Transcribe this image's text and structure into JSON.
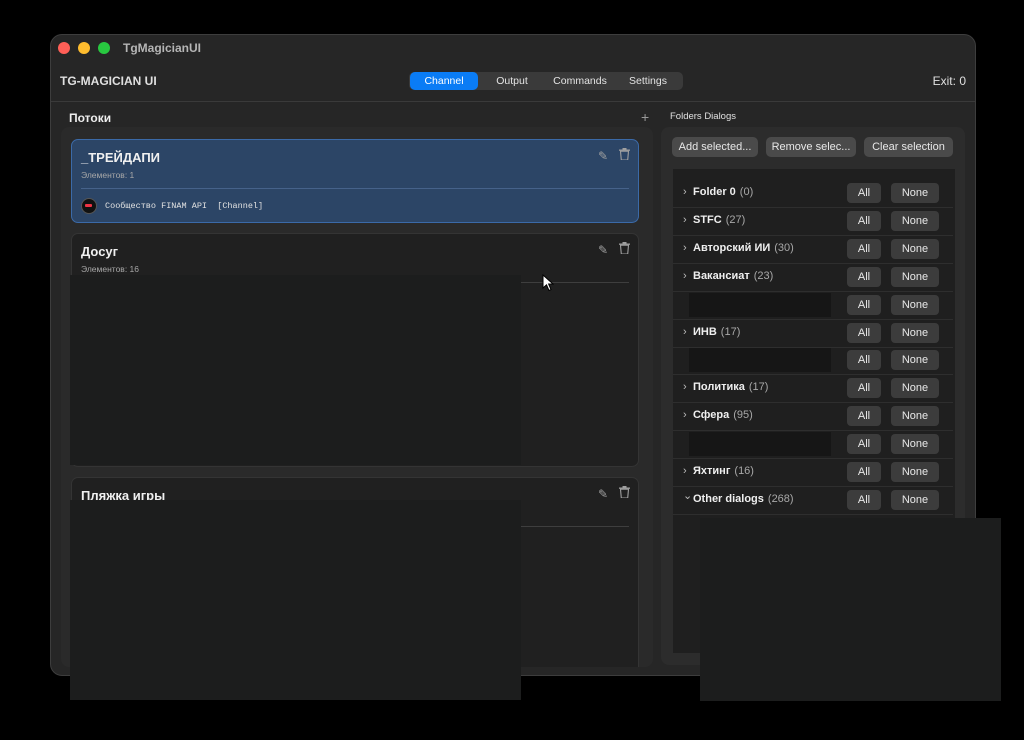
{
  "window": {
    "title": "TgMagicianUI"
  },
  "toolbar": {
    "app_title": "TG-MAGICIAN UI",
    "tabs": [
      "Channel",
      "Output",
      "Commands",
      "Settings"
    ],
    "active_tab": "Channel",
    "exit_label": "Exit: 0"
  },
  "left": {
    "title": "Потоки",
    "add_icon": "+",
    "cards": [
      {
        "title": "_ТРЕЙДАПИ",
        "subtitle": "Элементов: 1",
        "selected": true,
        "channels": [
          {
            "text": "Сообщество FINAM API  [Channel]"
          }
        ]
      },
      {
        "title": "Досуг",
        "subtitle": "Элементов: 16",
        "selected": false
      },
      {
        "title": "Пляжка игры",
        "subtitle": "",
        "selected": false
      }
    ]
  },
  "right": {
    "title": "Folders Dialogs",
    "actions": [
      "Add selected...",
      "Remove selec...",
      "Clear selection"
    ],
    "all_label": "All",
    "none_label": "None",
    "folders": [
      {
        "name": "Folder 0",
        "count": "(0)",
        "expanded": false
      },
      {
        "name": "STFC",
        "count": "(27)",
        "expanded": false
      },
      {
        "name": "Авторский ИИ",
        "count": "(30)",
        "expanded": false
      },
      {
        "name": "Вакансиат",
        "count": "(23)",
        "expanded": false
      },
      {
        "name": "",
        "count": "",
        "redacted": true
      },
      {
        "name": "ИНВ",
        "count": "(17)",
        "expanded": false
      },
      {
        "name": "",
        "count": "",
        "redacted": true
      },
      {
        "name": "Политика",
        "count": "(17)",
        "expanded": false
      },
      {
        "name": "Сфера",
        "count": "(95)",
        "expanded": false
      },
      {
        "name": "",
        "count": "",
        "redacted": true
      },
      {
        "name": "Яхтинг",
        "count": "(16)",
        "expanded": false
      },
      {
        "name": "Other dialogs",
        "count": "(268)",
        "expanded": true
      }
    ]
  },
  "icons": {
    "chevron_right": "›",
    "chevron_down": "⌄",
    "edit": "pencil-icon",
    "delete": "trash-icon"
  },
  "colors": {
    "accent": "#0a7cf5",
    "selected_card": "#2c4566"
  }
}
